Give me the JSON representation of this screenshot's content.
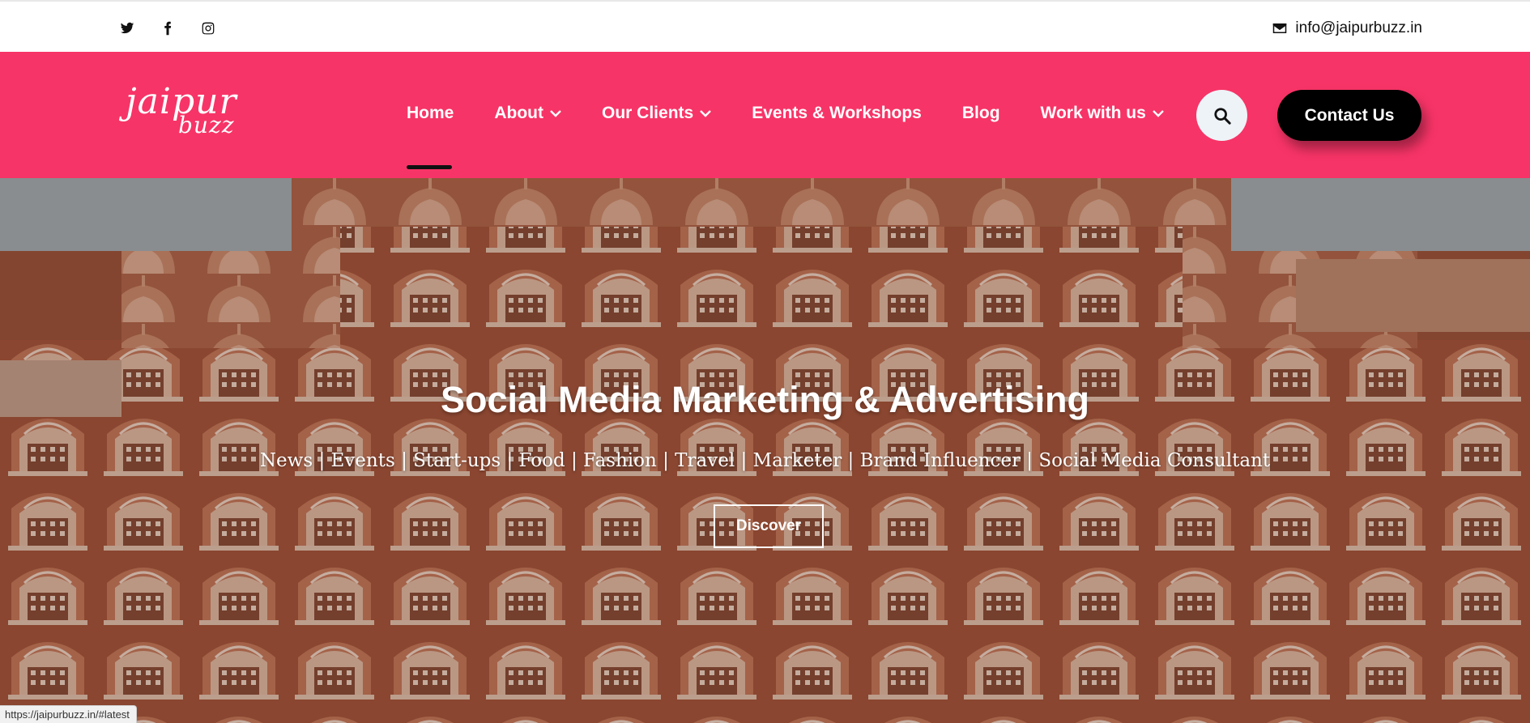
{
  "topbar": {
    "social": [
      {
        "icon": "twitter-icon",
        "label": "Twitter"
      },
      {
        "icon": "facebook-icon",
        "label": "Facebook"
      },
      {
        "icon": "instagram-icon",
        "label": "Instagram"
      }
    ],
    "email": "info@jaipurbuzz.in"
  },
  "header": {
    "logo_line1": "jaipur",
    "logo_line2": "buzz",
    "nav": [
      {
        "label": "Home",
        "active": true,
        "dropdown": false
      },
      {
        "label": "About",
        "dropdown": true
      },
      {
        "label": "Our Clients",
        "dropdown": true
      },
      {
        "label": "Events & Workshops",
        "dropdown": false
      },
      {
        "label": "Blog",
        "dropdown": false
      },
      {
        "label": "Work with us",
        "dropdown": true
      }
    ],
    "contact_label": "Contact Us"
  },
  "hero": {
    "title": "Social Media Marketing & Advertising",
    "subtitle": "News | Events | Start-ups | Food | Fashion | Travel | Marketer | Brand Influencer | Social Media Consultant",
    "button_label": "Discover"
  },
  "statusbar": {
    "url": "https://jaipurbuzz.in/#latest"
  },
  "colors": {
    "brand": "#f73467",
    "button_dark": "#000000"
  }
}
